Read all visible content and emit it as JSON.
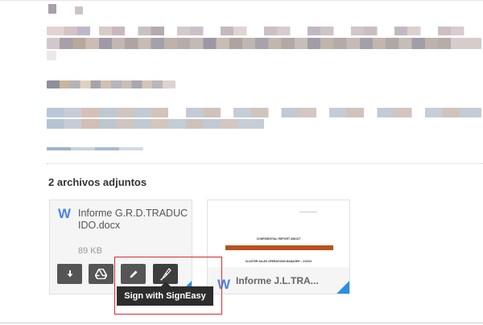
{
  "attachments": {
    "title": "2 archivos adjuntos",
    "items": [
      {
        "type_icon": "word-icon",
        "type_letter": "W",
        "name": "Informe G.R.D.TRADUCIDO.docx",
        "size": "89 KB"
      },
      {
        "type_icon": "word-icon",
        "type_letter": "W",
        "name": "Informe J.L.TRA...",
        "thumbnail_lines": [
          "CONFIDENTIAL REPORT ABOUT",
          "CLUSTER SALES OPERATIONS MANAGER – XXXXX"
        ]
      }
    ]
  },
  "actions": {
    "download_icon": "download-icon",
    "drive_icon": "google-drive-icon",
    "edit_icon": "pencil-icon",
    "sign_icon": "fountain-pen-icon"
  },
  "tooltip": {
    "text": "Sign with SignEasy"
  },
  "colors": {
    "accent": "#4a86e8",
    "button": "#555555",
    "highlight": "#d52b2b",
    "corner": "#2a8ee6"
  }
}
